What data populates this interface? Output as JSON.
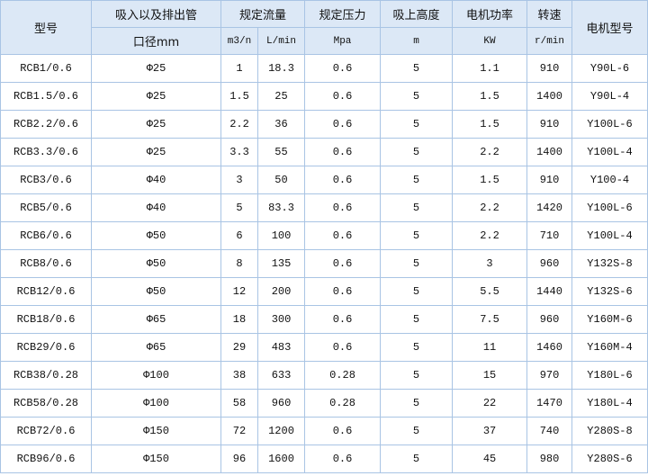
{
  "header": {
    "model": "型号",
    "pipe_top": "吸入以及排出管",
    "pipe_bottom": "口径mm",
    "flow": "规定流量",
    "flow_unit_m3": "m3/n",
    "flow_unit_l": "L/min",
    "pressure": "规定压力",
    "pressure_unit": "Mpa",
    "suction": "吸上高度",
    "suction_unit": "m",
    "power": "电机功率",
    "power_unit": "KW",
    "speed": "转速",
    "speed_unit": "r/min",
    "motor": "电机型号"
  },
  "rows": [
    {
      "model": "RCB1/0.6",
      "pipe": "Φ25",
      "m3": "1",
      "lmin": "18.3",
      "pressure": "0.6",
      "suction": "5",
      "power": "1.1",
      "speed": "910",
      "motor": "Y90L-6"
    },
    {
      "model": "RCB1.5/0.6",
      "pipe": "Φ25",
      "m3": "1.5",
      "lmin": "25",
      "pressure": "0.6",
      "suction": "5",
      "power": "1.5",
      "speed": "1400",
      "motor": "Y90L-4"
    },
    {
      "model": "RCB2.2/0.6",
      "pipe": "Φ25",
      "m3": "2.2",
      "lmin": "36",
      "pressure": "0.6",
      "suction": "5",
      "power": "1.5",
      "speed": "910",
      "motor": "Y100L-6"
    },
    {
      "model": "RCB3.3/0.6",
      "pipe": "Φ25",
      "m3": "3.3",
      "lmin": "55",
      "pressure": "0.6",
      "suction": "5",
      "power": "2.2",
      "speed": "1400",
      "motor": "Y100L-4"
    },
    {
      "model": "RCB3/0.6",
      "pipe": "Φ40",
      "m3": "3",
      "lmin": "50",
      "pressure": "0.6",
      "suction": "5",
      "power": "1.5",
      "speed": "910",
      "motor": "Y100-4"
    },
    {
      "model": "RCB5/0.6",
      "pipe": "Φ40",
      "m3": "5",
      "lmin": "83.3",
      "pressure": "0.6",
      "suction": "5",
      "power": "2.2",
      "speed": "1420",
      "motor": "Y100L-6"
    },
    {
      "model": "RCB6/0.6",
      "pipe": "Φ50",
      "m3": "6",
      "lmin": "100",
      "pressure": "0.6",
      "suction": "5",
      "power": "2.2",
      "speed": "710",
      "motor": "Y100L-4"
    },
    {
      "model": "RCB8/0.6",
      "pipe": "Φ50",
      "m3": "8",
      "lmin": "135",
      "pressure": "0.6",
      "suction": "5",
      "power": "3",
      "speed": "960",
      "motor": "Y132S-8"
    },
    {
      "model": "RCB12/0.6",
      "pipe": "Φ50",
      "m3": "12",
      "lmin": "200",
      "pressure": "0.6",
      "suction": "5",
      "power": "5.5",
      "speed": "1440",
      "motor": "Y132S-6"
    },
    {
      "model": "RCB18/0.6",
      "pipe": "Φ65",
      "m3": "18",
      "lmin": "300",
      "pressure": "0.6",
      "suction": "5",
      "power": "7.5",
      "speed": "960",
      "motor": "Y160M-6"
    },
    {
      "model": "RCB29/0.6",
      "pipe": "Φ65",
      "m3": "29",
      "lmin": "483",
      "pressure": "0.6",
      "suction": "5",
      "power": "11",
      "speed": "1460",
      "motor": "Y160M-4"
    },
    {
      "model": "RCB38/0.28",
      "pipe": "Φ100",
      "m3": "38",
      "lmin": "633",
      "pressure": "0.28",
      "suction": "5",
      "power": "15",
      "speed": "970",
      "motor": "Y180L-6"
    },
    {
      "model": "RCB58/0.28",
      "pipe": "Φ100",
      "m3": "58",
      "lmin": "960",
      "pressure": "0.28",
      "suction": "5",
      "power": "22",
      "speed": "1470",
      "motor": "Y180L-4"
    },
    {
      "model": "RCB72/0.6",
      "pipe": "Φ150",
      "m3": "72",
      "lmin": "1200",
      "pressure": "0.6",
      "suction": "5",
      "power": "37",
      "speed": "740",
      "motor": "Y280S-8"
    },
    {
      "model": "RCB96/0.6",
      "pipe": "Φ150",
      "m3": "96",
      "lmin": "1600",
      "pressure": "0.6",
      "suction": "5",
      "power": "45",
      "speed": "980",
      "motor": "Y280S-6"
    }
  ],
  "colors": {
    "header_bg": "#dce8f6",
    "border": "#a9c4e4",
    "text": "#111111"
  }
}
